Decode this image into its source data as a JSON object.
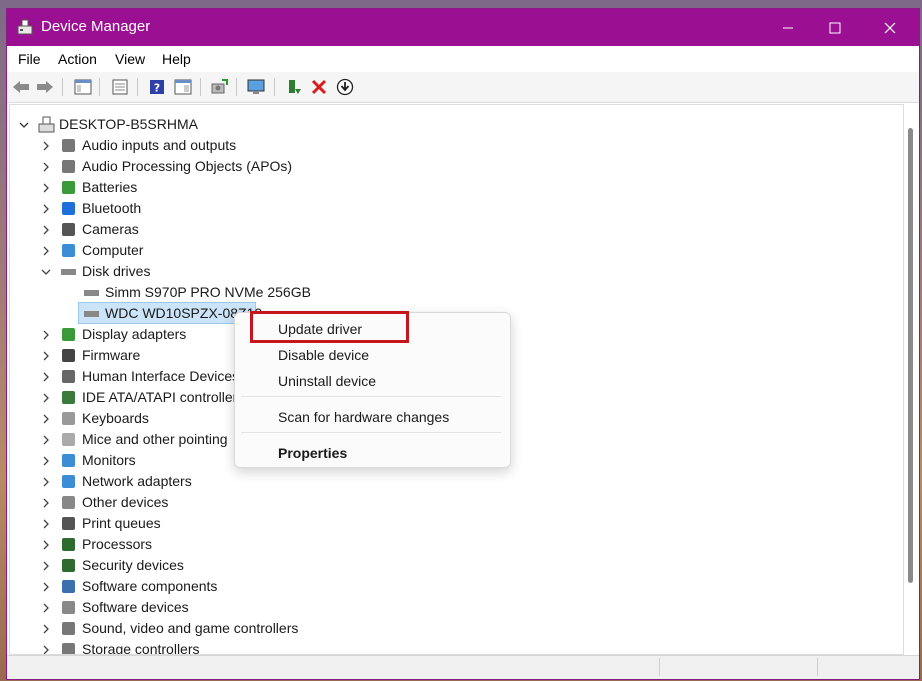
{
  "window": {
    "title": "Device Manager"
  },
  "menu": [
    "File",
    "Action",
    "View",
    "Help"
  ],
  "toolbar_icons": [
    "back-arrow-icon",
    "forward-arrow-icon",
    "show-hide-tree-icon",
    "properties-icon",
    "help-icon",
    "action-pane-icon",
    "update-driver-icon",
    "scan-hardware-icon",
    "enable-device-icon",
    "uninstall-icon",
    "download-icon"
  ],
  "tree": {
    "root": "DESKTOP-B5SRHMA",
    "categories": [
      {
        "label": "Audio inputs and outputs",
        "icon": "speaker-icon"
      },
      {
        "label": "Audio Processing Objects (APOs)",
        "icon": "speaker-icon"
      },
      {
        "label": "Batteries",
        "icon": "battery-icon"
      },
      {
        "label": "Bluetooth",
        "icon": "bluetooth-icon"
      },
      {
        "label": "Cameras",
        "icon": "camera-icon"
      },
      {
        "label": "Computer",
        "icon": "monitor-icon"
      },
      {
        "label": "Disk drives",
        "icon": "disk-drive-icon",
        "expanded": true,
        "children": [
          "Simm S970P PRO NVMe 256GB",
          "WDC WD10SPZX-08Z10"
        ]
      },
      {
        "label": "Display adapters",
        "icon": "display-adapter-icon"
      },
      {
        "label": "Firmware",
        "icon": "firmware-icon"
      },
      {
        "label": "Human Interface Devices",
        "icon": "hid-icon"
      },
      {
        "label": "IDE ATA/ATAPI controllers",
        "icon": "ide-controller-icon"
      },
      {
        "label": "Keyboards",
        "icon": "keyboard-icon"
      },
      {
        "label": "Mice and other pointing",
        "icon": "mouse-icon"
      },
      {
        "label": "Monitors",
        "icon": "monitor-icon"
      },
      {
        "label": "Network adapters",
        "icon": "network-icon"
      },
      {
        "label": "Other devices",
        "icon": "unknown-device-icon"
      },
      {
        "label": "Print queues",
        "icon": "printer-icon"
      },
      {
        "label": "Processors",
        "icon": "processor-icon"
      },
      {
        "label": "Security devices",
        "icon": "security-icon"
      },
      {
        "label": "Software components",
        "icon": "puzzle-icon"
      },
      {
        "label": "Software devices",
        "icon": "software-device-icon"
      },
      {
        "label": "Sound, video and game controllers",
        "icon": "speaker-icon"
      },
      {
        "label": "Storage controllers",
        "icon": "storage-icon"
      }
    ]
  },
  "context_menu": {
    "items": [
      "Update driver",
      "Disable device",
      "Uninstall device",
      "Scan for hardware changes",
      "Properties"
    ],
    "highlighted": "Update driver"
  },
  "colors": {
    "titlebar": "#9b0f93",
    "highlight_box": "#c4161c",
    "selection": "#cce4f7"
  }
}
